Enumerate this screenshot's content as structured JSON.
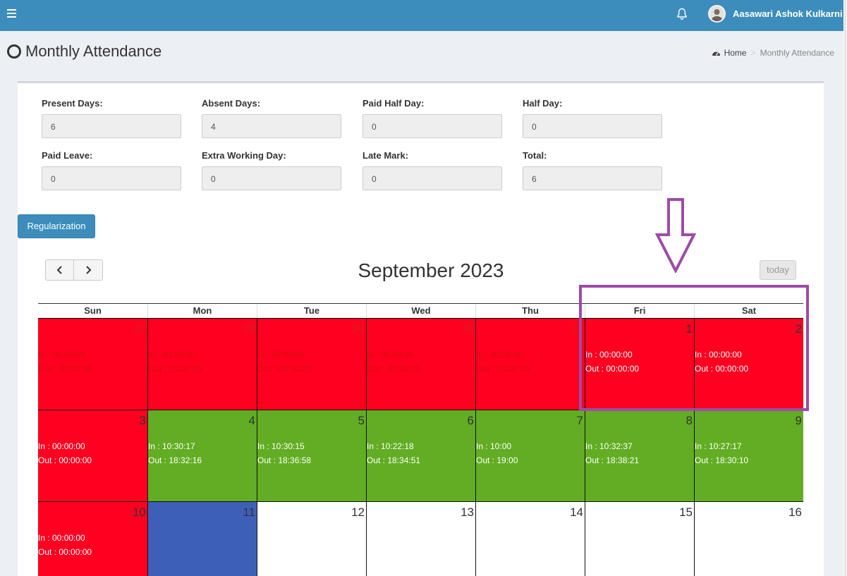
{
  "header": {
    "user_name": "Aasawari Ashok Kulkarni"
  },
  "page": {
    "title": "Monthly Attendance"
  },
  "breadcrumb": {
    "home": "Home",
    "separator": ">",
    "current": "Monthly Attendance"
  },
  "summary": {
    "present_label": "Present Days:",
    "present_value": "6",
    "absent_label": "Absent Days:",
    "absent_value": "4",
    "paid_half_label": "Paid Half Day:",
    "paid_half_value": "0",
    "half_day_label": "Half Day:",
    "half_day_value": "0",
    "paid_leave_label": "Paid Leave:",
    "paid_leave_value": "0",
    "extra_label": "Extra Working Day:",
    "extra_value": "0",
    "late_label": "Late Mark:",
    "late_value": "0",
    "total_label": "Total:",
    "total_value": "6"
  },
  "actions": {
    "regularization": "Regularization",
    "today": "today"
  },
  "calendar": {
    "month_title": "September 2023",
    "weekdays": [
      "Sun",
      "Mon",
      "Tue",
      "Wed",
      "Thu",
      "Fri",
      "Sat"
    ],
    "weeks": [
      [
        {
          "day": "27",
          "in": "In : 00:00:00",
          "out": "Out : 00:00:00"
        },
        {
          "day": "28",
          "in": "In : 00:00:00",
          "out": "Out : 00:00:00"
        },
        {
          "day": "29",
          "in": "In : 00:00:00",
          "out": "Out : 00:00:00"
        },
        {
          "day": "30",
          "in": "In : 00:00:00",
          "out": "Out : 00:00:00"
        },
        {
          "day": "31",
          "in": "In : 00:00:00",
          "out": "Out : 00:00:00"
        },
        {
          "day": "1",
          "in": "In : 00:00:00",
          "out": "Out : 00:00:00"
        },
        {
          "day": "2",
          "in": "In : 00:00:00",
          "out": "Out : 00:00:00"
        }
      ],
      [
        {
          "day": "3",
          "in": "In : 00:00:00",
          "out": "Out : 00:00:00"
        },
        {
          "day": "4",
          "in": "In : 10:30:17",
          "out": "Out : 18:32:16"
        },
        {
          "day": "5",
          "in": "In : 10:30:15",
          "out": "Out : 18:36:58"
        },
        {
          "day": "6",
          "in": "In : 10:22:18",
          "out": "Out : 18:34:51"
        },
        {
          "day": "7",
          "in": "In : 10:00",
          "out": "Out : 19:00"
        },
        {
          "day": "8",
          "in": "In : 10:32:37",
          "out": "Out : 18:38:21"
        },
        {
          "day": "9",
          "in": "In : 10:27:17",
          "out": "Out : 18:30:10"
        }
      ],
      [
        {
          "day": "10",
          "in": "In : 00:00:00",
          "out": "Out : 00:00:00"
        },
        {
          "day": "11"
        },
        {
          "day": "12"
        },
        {
          "day": "13"
        },
        {
          "day": "14"
        },
        {
          "day": "15"
        },
        {
          "day": "16"
        }
      ]
    ]
  },
  "colors": {
    "header": "#3c8dbc",
    "absent": "#ff0020",
    "present": "#62ad23",
    "today": "#3d5fb8",
    "annotation": "#9e4ba8"
  }
}
